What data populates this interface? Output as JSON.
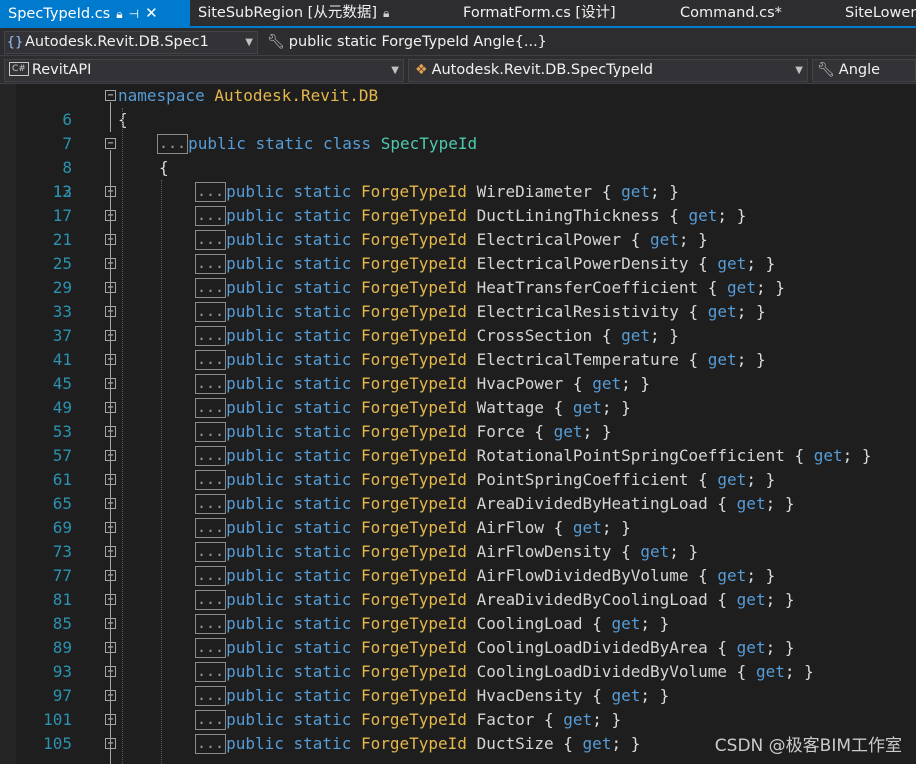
{
  "tabs": [
    {
      "label": "SpecTypeId.cs",
      "active": true,
      "icons": [
        "lock-icon",
        "pin-icon",
        "close-icon"
      ]
    },
    {
      "label": "SiteSubRegion [从元数据]",
      "active": false,
      "icons": [
        "lock-icon"
      ]
    },
    {
      "label": "FormatForm.cs [设计]",
      "active": false,
      "icons": []
    },
    {
      "label": "Command.cs*",
      "active": false,
      "icons": []
    },
    {
      "label": "SiteLower",
      "active": false,
      "icons": []
    }
  ],
  "nav1": {
    "type_combo": "Autodesk.Revit.DB.Spec1",
    "member_combo": "public static ForgeTypeId Angle{...}"
  },
  "nav2": {
    "project_combo": "RevitAPI",
    "project_badge": "C#",
    "type_combo": "Autodesk.Revit.DB.SpecTypeId",
    "member_combo": "Angle"
  },
  "editor": {
    "namespace_keyword": "namespace",
    "namespace_name": "Autodesk.Revit.DB",
    "open_brace": "{",
    "ellipsis": "...",
    "class_decl": {
      "mods": "public static class",
      "name": "SpecTypeId"
    },
    "prop_mods": "public static",
    "prop_type": "ForgeTypeId",
    "accessor_get": "get",
    "lines": [
      {
        "num": "6"
      },
      {
        "num": "7"
      },
      {
        "num": "8"
      },
      {
        "num": "12"
      }
    ],
    "properties": [
      {
        "num": "13",
        "name": "WireDiameter"
      },
      {
        "num": "17",
        "name": "DuctLiningThickness"
      },
      {
        "num": "21",
        "name": "ElectricalPower"
      },
      {
        "num": "25",
        "name": "ElectricalPowerDensity"
      },
      {
        "num": "29",
        "name": "HeatTransferCoefficient"
      },
      {
        "num": "33",
        "name": "ElectricalResistivity"
      },
      {
        "num": "37",
        "name": "CrossSection"
      },
      {
        "num": "41",
        "name": "ElectricalTemperature"
      },
      {
        "num": "45",
        "name": "HvacPower"
      },
      {
        "num": "49",
        "name": "Wattage"
      },
      {
        "num": "53",
        "name": "Force"
      },
      {
        "num": "57",
        "name": "RotationalPointSpringCoefficient"
      },
      {
        "num": "61",
        "name": "PointSpringCoefficient"
      },
      {
        "num": "65",
        "name": "AreaDividedByHeatingLoad"
      },
      {
        "num": "69",
        "name": "AirFlow"
      },
      {
        "num": "73",
        "name": "AirFlowDensity"
      },
      {
        "num": "77",
        "name": "AirFlowDividedByVolume"
      },
      {
        "num": "81",
        "name": "AreaDividedByCoolingLoad"
      },
      {
        "num": "85",
        "name": "CoolingLoad"
      },
      {
        "num": "89",
        "name": "CoolingLoadDividedByArea"
      },
      {
        "num": "93",
        "name": "CoolingLoadDividedByVolume"
      },
      {
        "num": "97",
        "name": "HvacDensity"
      },
      {
        "num": "101",
        "name": "Factor"
      },
      {
        "num": "105",
        "name": "DuctSize"
      }
    ]
  },
  "watermark": "CSDN @极客BIM工作室",
  "colors": {
    "tab_active": "#007acc",
    "keyword": "#569cd6",
    "type": "#e5b74c",
    "class": "#4ec9b0",
    "line_number": "#2b91af",
    "background": "#1e1e1e"
  }
}
